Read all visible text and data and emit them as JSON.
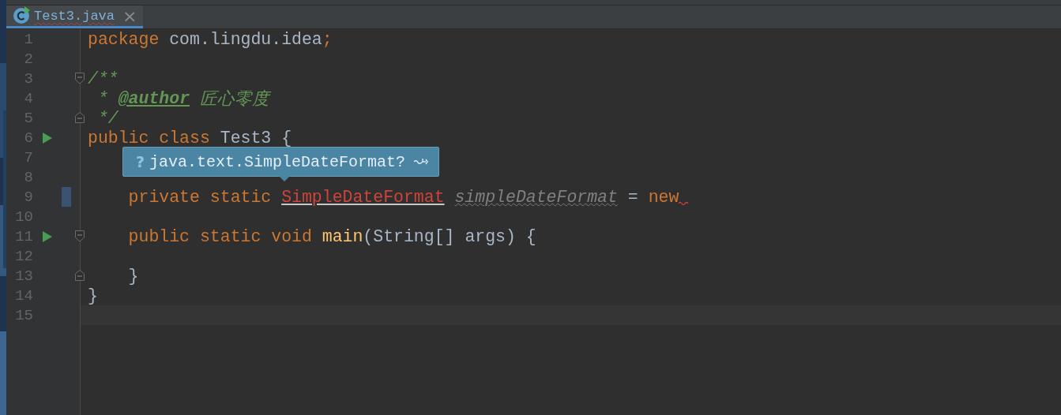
{
  "tabs": [
    {
      "label": "Test3.java",
      "selected": true,
      "close": "×"
    }
  ],
  "lines": [
    {
      "number": "1",
      "tokens": [
        {
          "kind": "keyword",
          "text": "package "
        },
        {
          "kind": "plain",
          "text": "com.lingdu.idea"
        },
        {
          "kind": "keyword",
          "text": ";"
        }
      ]
    },
    {
      "number": "2"
    },
    {
      "number": "3",
      "fold_start": true,
      "tokens": [
        {
          "kind": "doc",
          "text": "/**"
        }
      ]
    },
    {
      "number": "4",
      "tokens": [
        {
          "kind": "doc",
          "text": " * "
        },
        {
          "kind": "doctag",
          "text": "@author"
        },
        {
          "kind": "doc",
          "text": " 匠心零度"
        }
      ]
    },
    {
      "number": "5",
      "fold_end": true,
      "tokens": [
        {
          "kind": "doc",
          "text": " */"
        }
      ]
    },
    {
      "number": "6",
      "run": true,
      "tokens": [
        {
          "kind": "keyword",
          "text": "public class "
        },
        {
          "kind": "plain",
          "text": "Test3 {"
        }
      ]
    },
    {
      "number": "7",
      "popup": {
        "mark": "?",
        "text": "java.text.SimpleDateFormat?"
      }
    },
    {
      "number": "8"
    },
    {
      "number": "9",
      "changed": true,
      "squiggle": true,
      "tokens": [
        {
          "kind": "keyword",
          "text": "    private static "
        },
        {
          "kind": "error",
          "text": "SimpleDateFormat"
        },
        {
          "kind": "unused",
          "text": "simpleDateFormat"
        },
        {
          "kind": "plain",
          "text": " = "
        },
        {
          "kind": "keyword",
          "text": "new"
        }
      ]
    },
    {
      "number": "10"
    },
    {
      "number": "11",
      "run": true,
      "fold_start": true,
      "tokens": [
        {
          "kind": "keyword",
          "text": "    public static void "
        },
        {
          "kind": "method",
          "text": "main"
        },
        {
          "kind": "plain",
          "text": "(String[] args) {"
        }
      ]
    },
    {
      "number": "12"
    },
    {
      "number": "13",
      "fold_end": true,
      "tokens": [
        {
          "kind": "plain",
          "text": "    }"
        }
      ]
    },
    {
      "number": "14",
      "tokens": [
        {
          "kind": "plain",
          "text": "}"
        }
      ]
    },
    {
      "number": "15",
      "current": true
    }
  ]
}
